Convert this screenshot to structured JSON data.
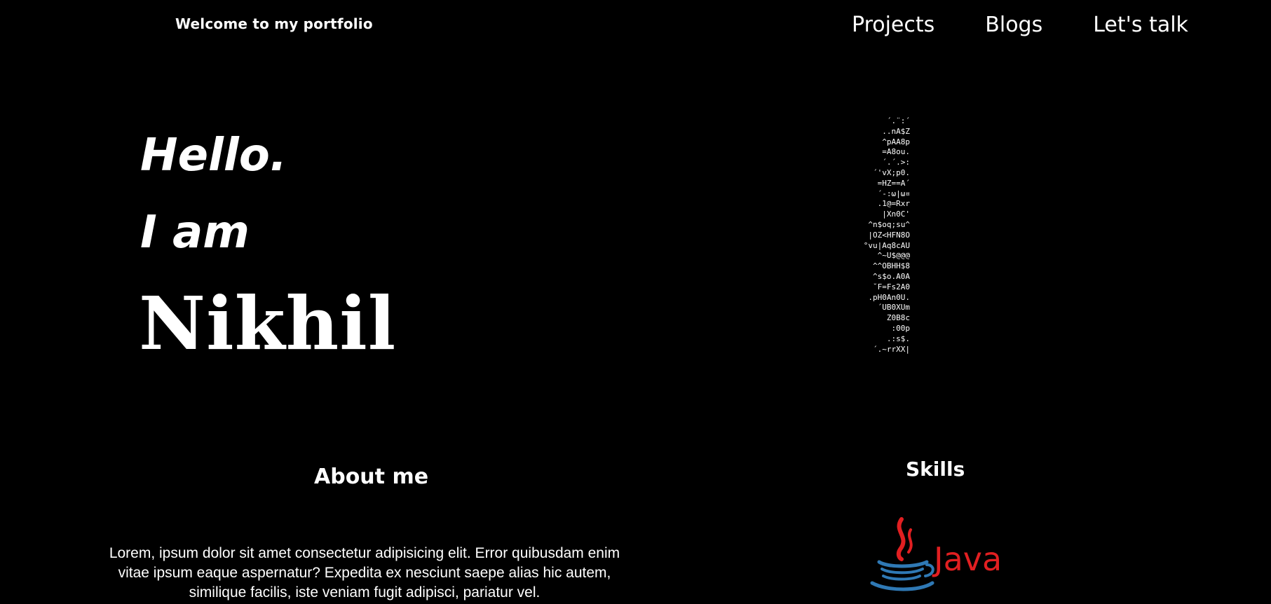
{
  "header": {
    "title": "Welcome to my portfolio"
  },
  "nav": {
    "items": [
      {
        "label": "Projects"
      },
      {
        "label": "Blogs"
      },
      {
        "label": "Let's talk"
      }
    ]
  },
  "hero": {
    "greeting": "Hello.",
    "intro": "I am",
    "name": "Nikhil",
    "ascii_art": "´.¨:´\n..nA$Z\n^pAA8p\n=A8ou.\n´.´.>:\n´'vX;p0.\n=HZ==A´\n´-:ω|ω¤\n.1@=Rxr\n|Xn0C'\n^n$oq;su^\n|OZ<HFN8O\n°vu|Aq8cAU\n^~U$@@@\n^^OBHH$8\n^s$o.A0A\n˘F=Fs2A0\n.pH0An0U.\n´UB0XUm\nZ0B8c\n:00p\n.:s$.\n´.~rrXX|"
  },
  "about": {
    "heading": "About me",
    "text": "Lorem, ipsum dolor sit amet consectetur adipisicing elit. Error quibusdam enim vitae ipsum eaque aspernatur? Expedita ex nesciunt saepe alias hic autem, similique facilis, iste veniam fugit adipisci, pariatur vel."
  },
  "skills": {
    "heading": "Skills",
    "items": [
      {
        "name": "Java",
        "icon": "java-logo"
      }
    ]
  },
  "colors": {
    "background": "#000000",
    "text": "#ffffff",
    "java_red": "#e11f21",
    "java_blue": "#2f79b5"
  }
}
